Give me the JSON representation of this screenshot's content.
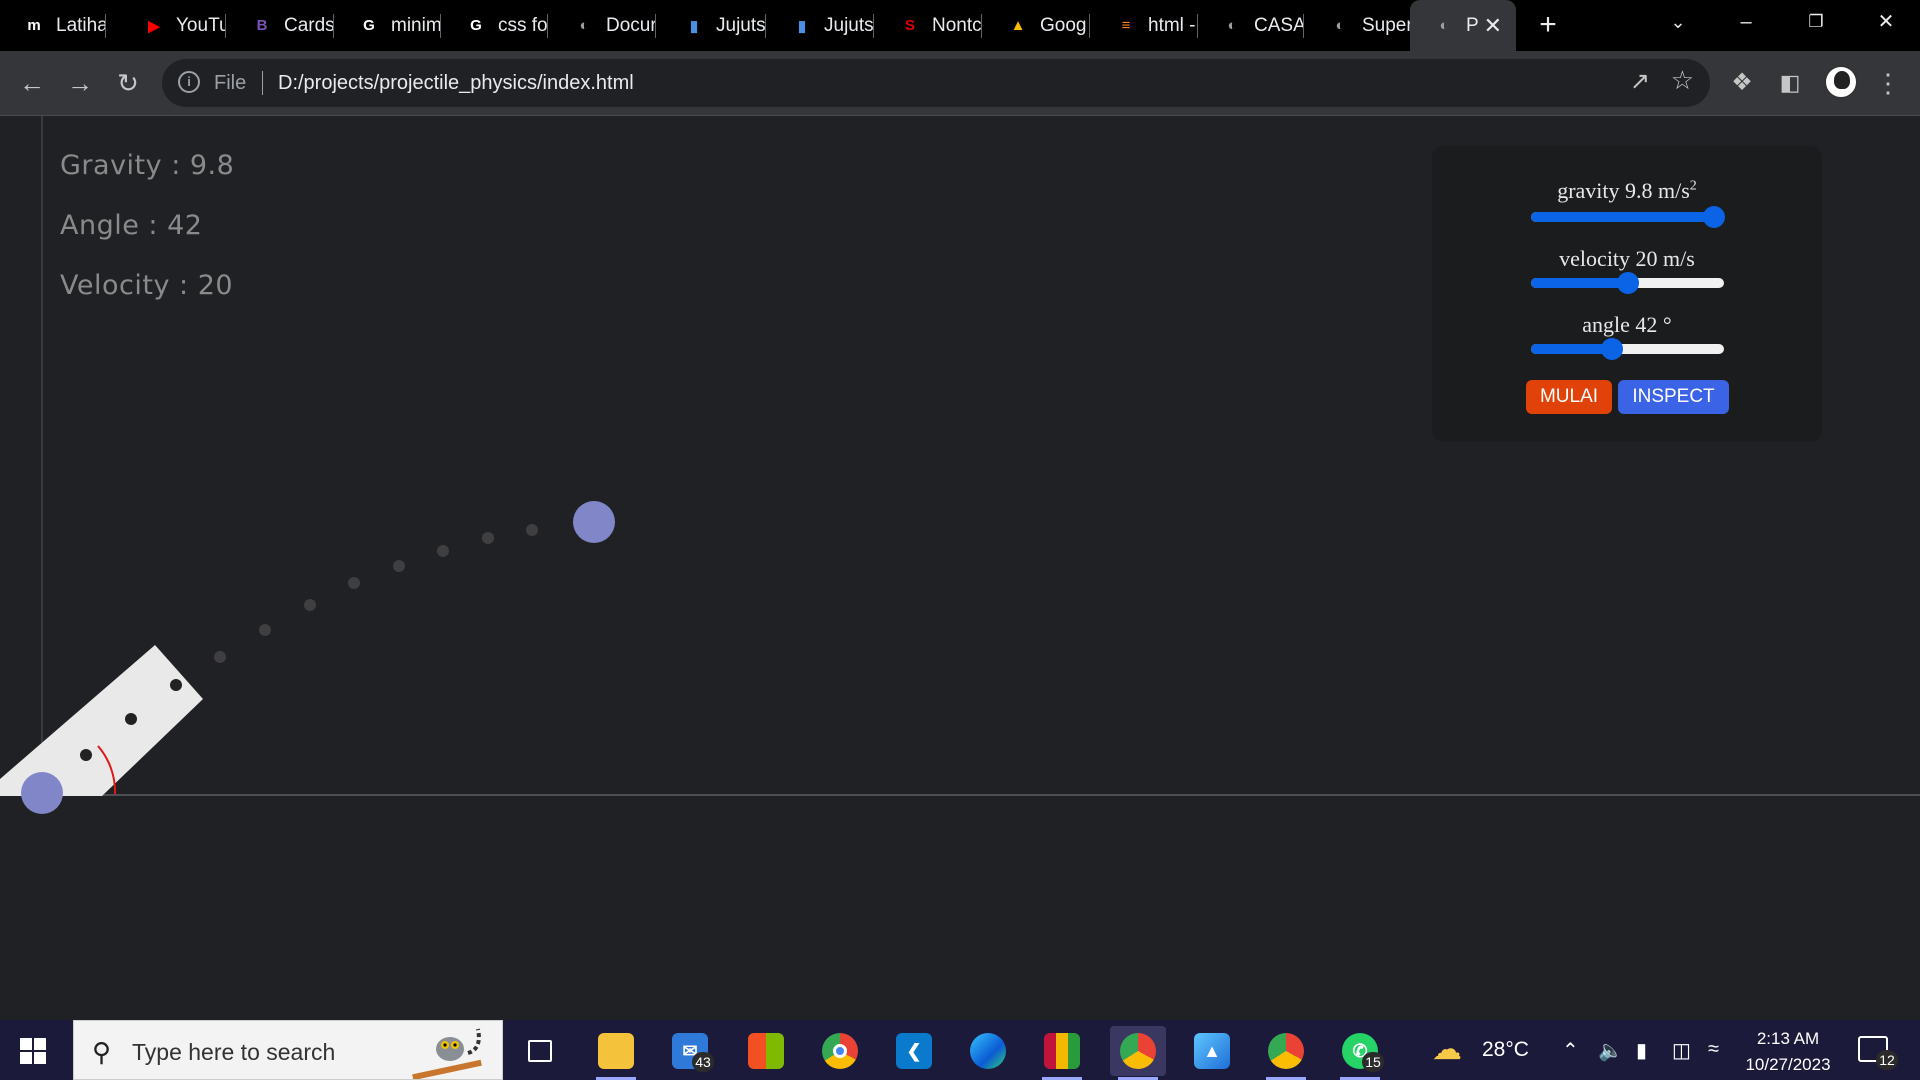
{
  "tabs": [
    {
      "title": "Latiha",
      "icon": "m-icon",
      "color": "#ffffff"
    },
    {
      "title": "YouTu",
      "icon": "youtube-icon",
      "color": "#ff0000"
    },
    {
      "title": "Cards",
      "icon": "bootstrap-icon",
      "color": "#7952b3"
    },
    {
      "title": "minim",
      "icon": "google-icon",
      "color": "#ffffff"
    },
    {
      "title": "css fo",
      "icon": "google-icon",
      "color": "#ffffff"
    },
    {
      "title": "Docur",
      "icon": "globe-icon",
      "color": "#9aa0a6"
    },
    {
      "title": "Jujutsi",
      "icon": "book-icon",
      "color": "#4a90e2"
    },
    {
      "title": "Jujutsi",
      "icon": "book-icon",
      "color": "#4a90e2"
    },
    {
      "title": "Nontc",
      "icon": "scribd-icon",
      "color": "#e00000"
    },
    {
      "title": "Goog",
      "icon": "drive-icon",
      "color": "#fbbc04"
    },
    {
      "title": "html -",
      "icon": "stackoverflow-icon",
      "color": "#f48024"
    },
    {
      "title": "CASA",
      "icon": "globe-icon",
      "color": "#9aa0a6"
    },
    {
      "title": "Super",
      "icon": "globe-icon",
      "color": "#9aa0a6"
    },
    {
      "title": "P",
      "icon": "globe-icon",
      "color": "#9aa0a6",
      "active": true
    }
  ],
  "address": {
    "scheme_label": "File",
    "url": "D:/projects/projectile_physics/index.html"
  },
  "stats": {
    "gravity_label": "Gravity : ",
    "gravity_value": "9.8",
    "angle_label": "Angle : ",
    "angle_value": "42",
    "velocity_label": "Velocity : ",
    "velocity_value": "20"
  },
  "controls": {
    "gravity": {
      "label": "gravity 9.8 m/s",
      "sup": "2",
      "level": 0.95
    },
    "velocity": {
      "label": "velocity 20 m/s",
      "level": 0.5
    },
    "angle": {
      "label": "angle 42 °",
      "level": 0.42
    },
    "start_label": "MULAI",
    "inspect_label": "INSPECT"
  },
  "taskbar": {
    "search_placeholder": "Type here to search",
    "mail_badge": "43",
    "whatsapp_badge": "15",
    "weather": "28°C",
    "time": "2:13 AM",
    "date": "10/27/2023",
    "notification_count": "12"
  },
  "colors": {
    "accent": "#0b63e6",
    "start_button": "#e0420a",
    "inspect_button": "#3a63e6",
    "ball": "#8186c8"
  }
}
